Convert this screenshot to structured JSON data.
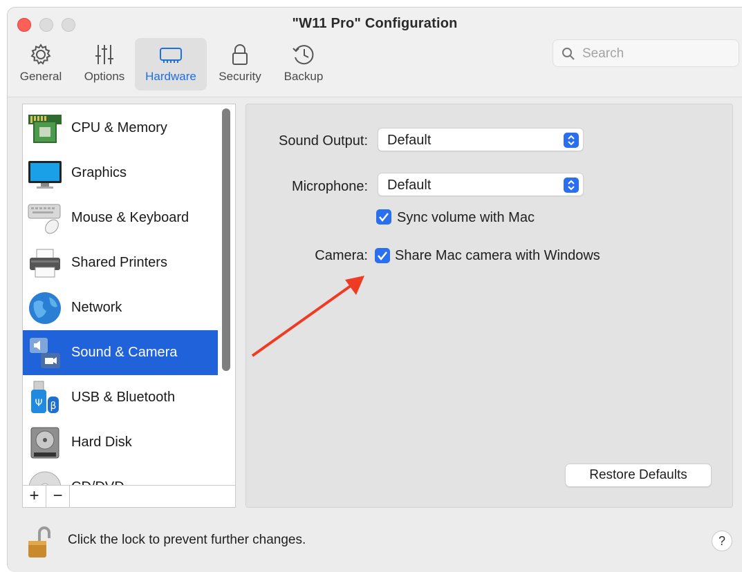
{
  "window": {
    "title": "\"W11 Pro\" Configuration"
  },
  "toolbar": {
    "items": [
      {
        "label": "General",
        "icon": "gear-icon"
      },
      {
        "label": "Options",
        "icon": "sliders-icon"
      },
      {
        "label": "Hardware",
        "icon": "chip-icon",
        "active": true
      },
      {
        "label": "Security",
        "icon": "lock-icon"
      },
      {
        "label": "Backup",
        "icon": "clock-history-icon"
      }
    ]
  },
  "search": {
    "placeholder": "Search"
  },
  "sidebar": {
    "items": [
      {
        "label": "CPU & Memory",
        "icon": "cpu-memory-icon"
      },
      {
        "label": "Graphics",
        "icon": "monitor-icon"
      },
      {
        "label": "Mouse & Keyboard",
        "icon": "mouse-keyboard-icon"
      },
      {
        "label": "Shared Printers",
        "icon": "printer-icon"
      },
      {
        "label": "Network",
        "icon": "globe-icon"
      },
      {
        "label": "Sound & Camera",
        "icon": "sound-camera-icon",
        "selected": true
      },
      {
        "label": "USB & Bluetooth",
        "icon": "usb-bluetooth-icon"
      },
      {
        "label": "Hard Disk",
        "icon": "hard-disk-icon"
      },
      {
        "label": "CD/DVD",
        "icon": "cd-dvd-icon"
      }
    ],
    "add_label": "+",
    "remove_label": "−"
  },
  "main": {
    "sound_output_label": "Sound Output:",
    "sound_output_value": "Default",
    "microphone_label": "Microphone:",
    "microphone_value": "Default",
    "sync_volume_label": "Sync volume with Mac",
    "sync_volume_checked": true,
    "camera_label": "Camera:",
    "share_camera_label": "Share Mac camera with Windows",
    "share_camera_checked": true,
    "restore_defaults_label": "Restore Defaults"
  },
  "footer": {
    "lock_message": "Click the lock to prevent further changes.",
    "help_label": "?"
  },
  "colors": {
    "accent": "#2062d9",
    "checkbox": "#2a6ff0",
    "annotation_arrow": "#ee3b24"
  }
}
